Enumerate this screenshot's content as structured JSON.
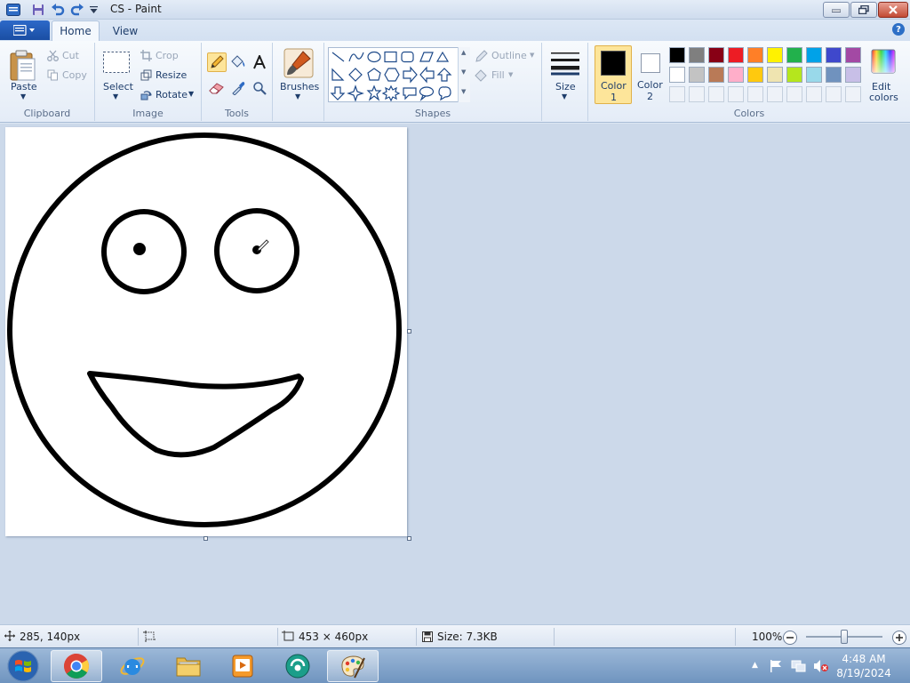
{
  "window": {
    "title": "CS - Paint"
  },
  "tabs": {
    "home": "Home",
    "view": "View"
  },
  "clipboard": {
    "paste": "Paste",
    "cut": "Cut",
    "copy": "Copy",
    "group": "Clipboard"
  },
  "image": {
    "select": "Select",
    "crop": "Crop",
    "resize": "Resize",
    "rotate": "Rotate",
    "group": "Image"
  },
  "tools": {
    "group": "Tools"
  },
  "brushes": {
    "label": "Brushes"
  },
  "shapes": {
    "outline": "Outline",
    "fill": "Fill",
    "group": "Shapes"
  },
  "size": {
    "label": "Size"
  },
  "colors": {
    "color1": "Color",
    "color1_num": "1",
    "color2": "Color",
    "color2_num": "2",
    "edit1": "Edit",
    "edit2": "colors",
    "group": "Colors",
    "color1_value": "#000000",
    "color2_value": "#ffffff",
    "palette_row1": [
      "#000000",
      "#7f7f7f",
      "#880015",
      "#ed1c24",
      "#ff7f27",
      "#fff200",
      "#22b14c",
      "#00a2e8",
      "#3f48cc",
      "#a349a4"
    ],
    "palette_row2": [
      "#ffffff",
      "#c3c3c3",
      "#b97a57",
      "#ffaec9",
      "#ffc90e",
      "#efe4b0",
      "#b5e61d",
      "#99d9ea",
      "#7092be",
      "#c8bfe7"
    ]
  },
  "status": {
    "cursor": "285, 140px",
    "dimensions": "453 × 460px",
    "size": "Size: 7.3KB",
    "zoom": "100%"
  },
  "taskbar": {
    "time": "4:48 AM",
    "date": "8/19/2024"
  }
}
